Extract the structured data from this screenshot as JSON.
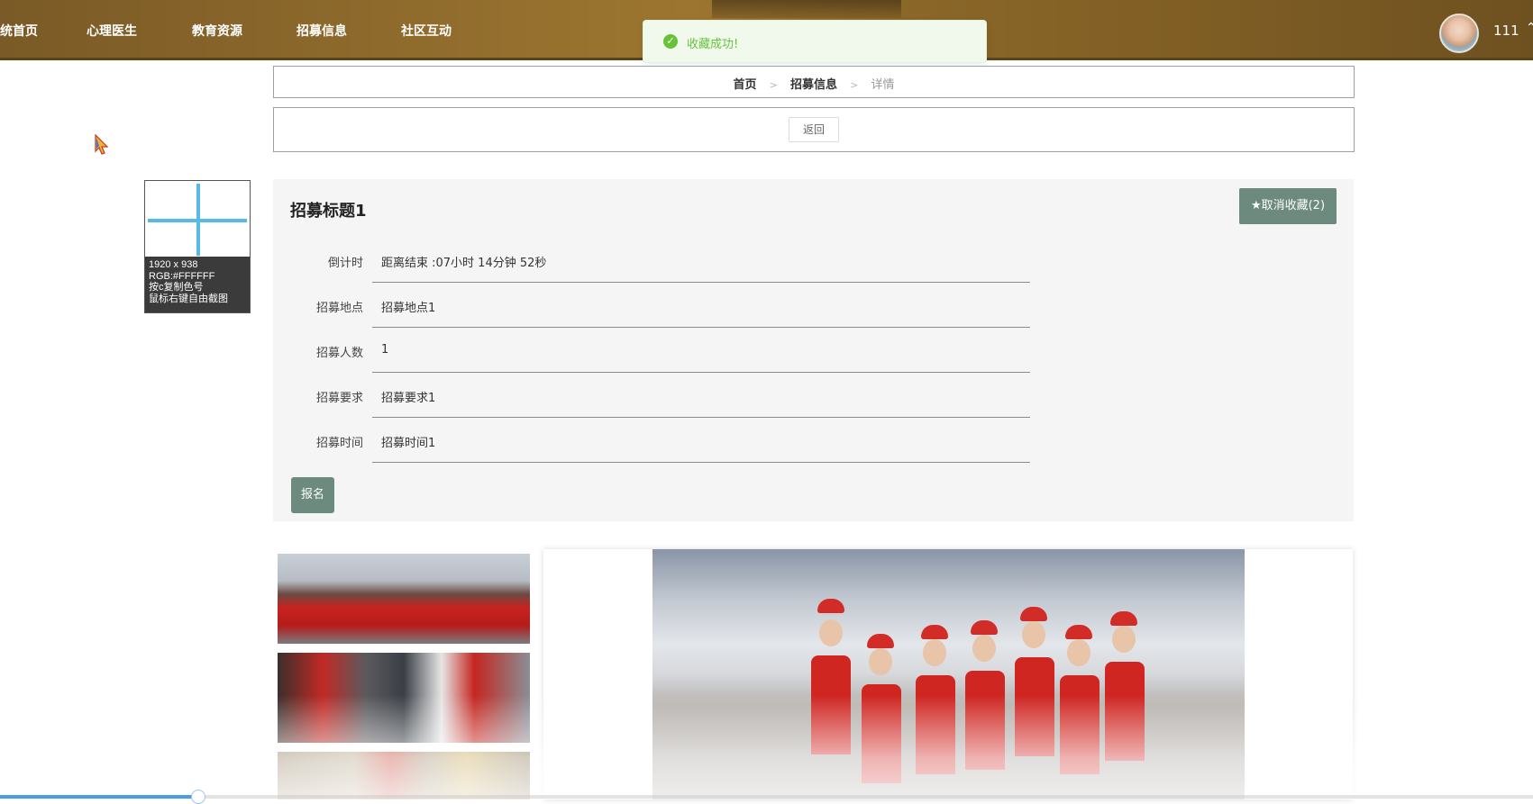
{
  "nav": {
    "items": [
      "统首页",
      "心理医生",
      "教育资源",
      "招募信息",
      "社区互动"
    ],
    "username": "111"
  },
  "toast": {
    "message": "收藏成功!"
  },
  "breadcrumb": {
    "home": "首页",
    "section": "招募信息",
    "current": "详情",
    "separator": ">"
  },
  "return_label": "返回",
  "picker": {
    "size": "1920 x 938",
    "rgb": "RGB:#FFFFFF",
    "hint1": "按c复制色号",
    "hint2": "鼠标右键自由截图"
  },
  "detail": {
    "title": "招募标题1",
    "favorite_label": "★取消收藏(2)",
    "rows": [
      {
        "label": "倒计时",
        "value": "距离结束 :07小时 14分钟 52秒"
      },
      {
        "label": "招募地点",
        "value": "招募地点1"
      },
      {
        "label": "招募人数",
        "value": "1"
      },
      {
        "label": "招募要求",
        "value": "招募要求1"
      },
      {
        "label": "招募时间",
        "value": "招募时间1"
      }
    ],
    "signup_label": "报名"
  },
  "colors": {
    "accent": "#6c8a7d",
    "nav_bg": "#8e6a2c",
    "toast_green": "#67c23a"
  }
}
